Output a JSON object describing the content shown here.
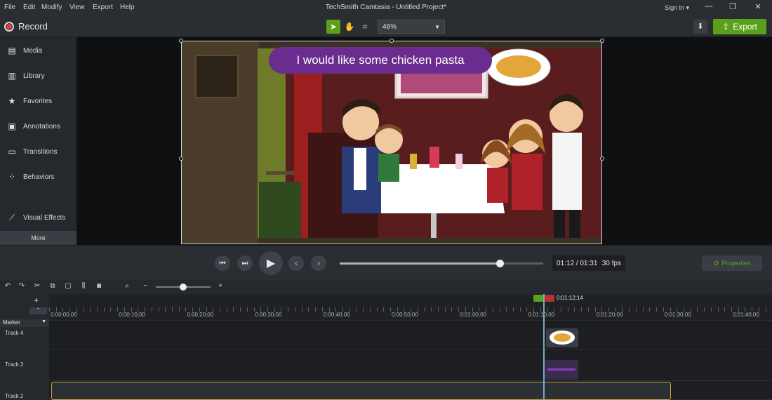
{
  "menubar": {
    "items": [
      "File",
      "Edit",
      "Modify",
      "View",
      "Export",
      "Help"
    ],
    "title": "TechSmith Camtasia - Untitled Project*",
    "signin": "Sign In ▾"
  },
  "toolbar": {
    "record_label": "Record",
    "zoom_value": "46%",
    "export_label": "Export"
  },
  "sidebar": {
    "items": [
      {
        "label": "Media",
        "icon": "media-icon"
      },
      {
        "label": "Library",
        "icon": "library-icon"
      },
      {
        "label": "Favorites",
        "icon": "star-icon"
      },
      {
        "label": "Annotations",
        "icon": "annotation-icon"
      },
      {
        "label": "Transitions",
        "icon": "transition-icon"
      },
      {
        "label": "Behaviors",
        "icon": "behavior-icon"
      },
      {
        "label": "Visual Effects",
        "icon": "wand-icon"
      }
    ],
    "more_label": "More"
  },
  "canvas": {
    "caption": "I would like some chicken pasta"
  },
  "playback": {
    "time": "01:12 / 01:31",
    "fps": "30 fps",
    "progress_fraction": 0.785,
    "properties_label": "Properties"
  },
  "timeline": {
    "zoom_fraction": 0.5,
    "playhead_time": "0:01:12;14",
    "marker_label": "Marker",
    "ruler_ticks": [
      "0:00:00;00",
      "0:00:10;00",
      "0:00:20;00",
      "0:00:30;00",
      "0:00:40;00",
      "0:00:50;00",
      "0:01:00;00",
      "0:01:10;00",
      "0:01:20;00",
      "0:01:30;00",
      "0:01:40;00"
    ],
    "tracks": [
      "Track 4",
      "Track 3",
      "Track 2"
    ]
  }
}
